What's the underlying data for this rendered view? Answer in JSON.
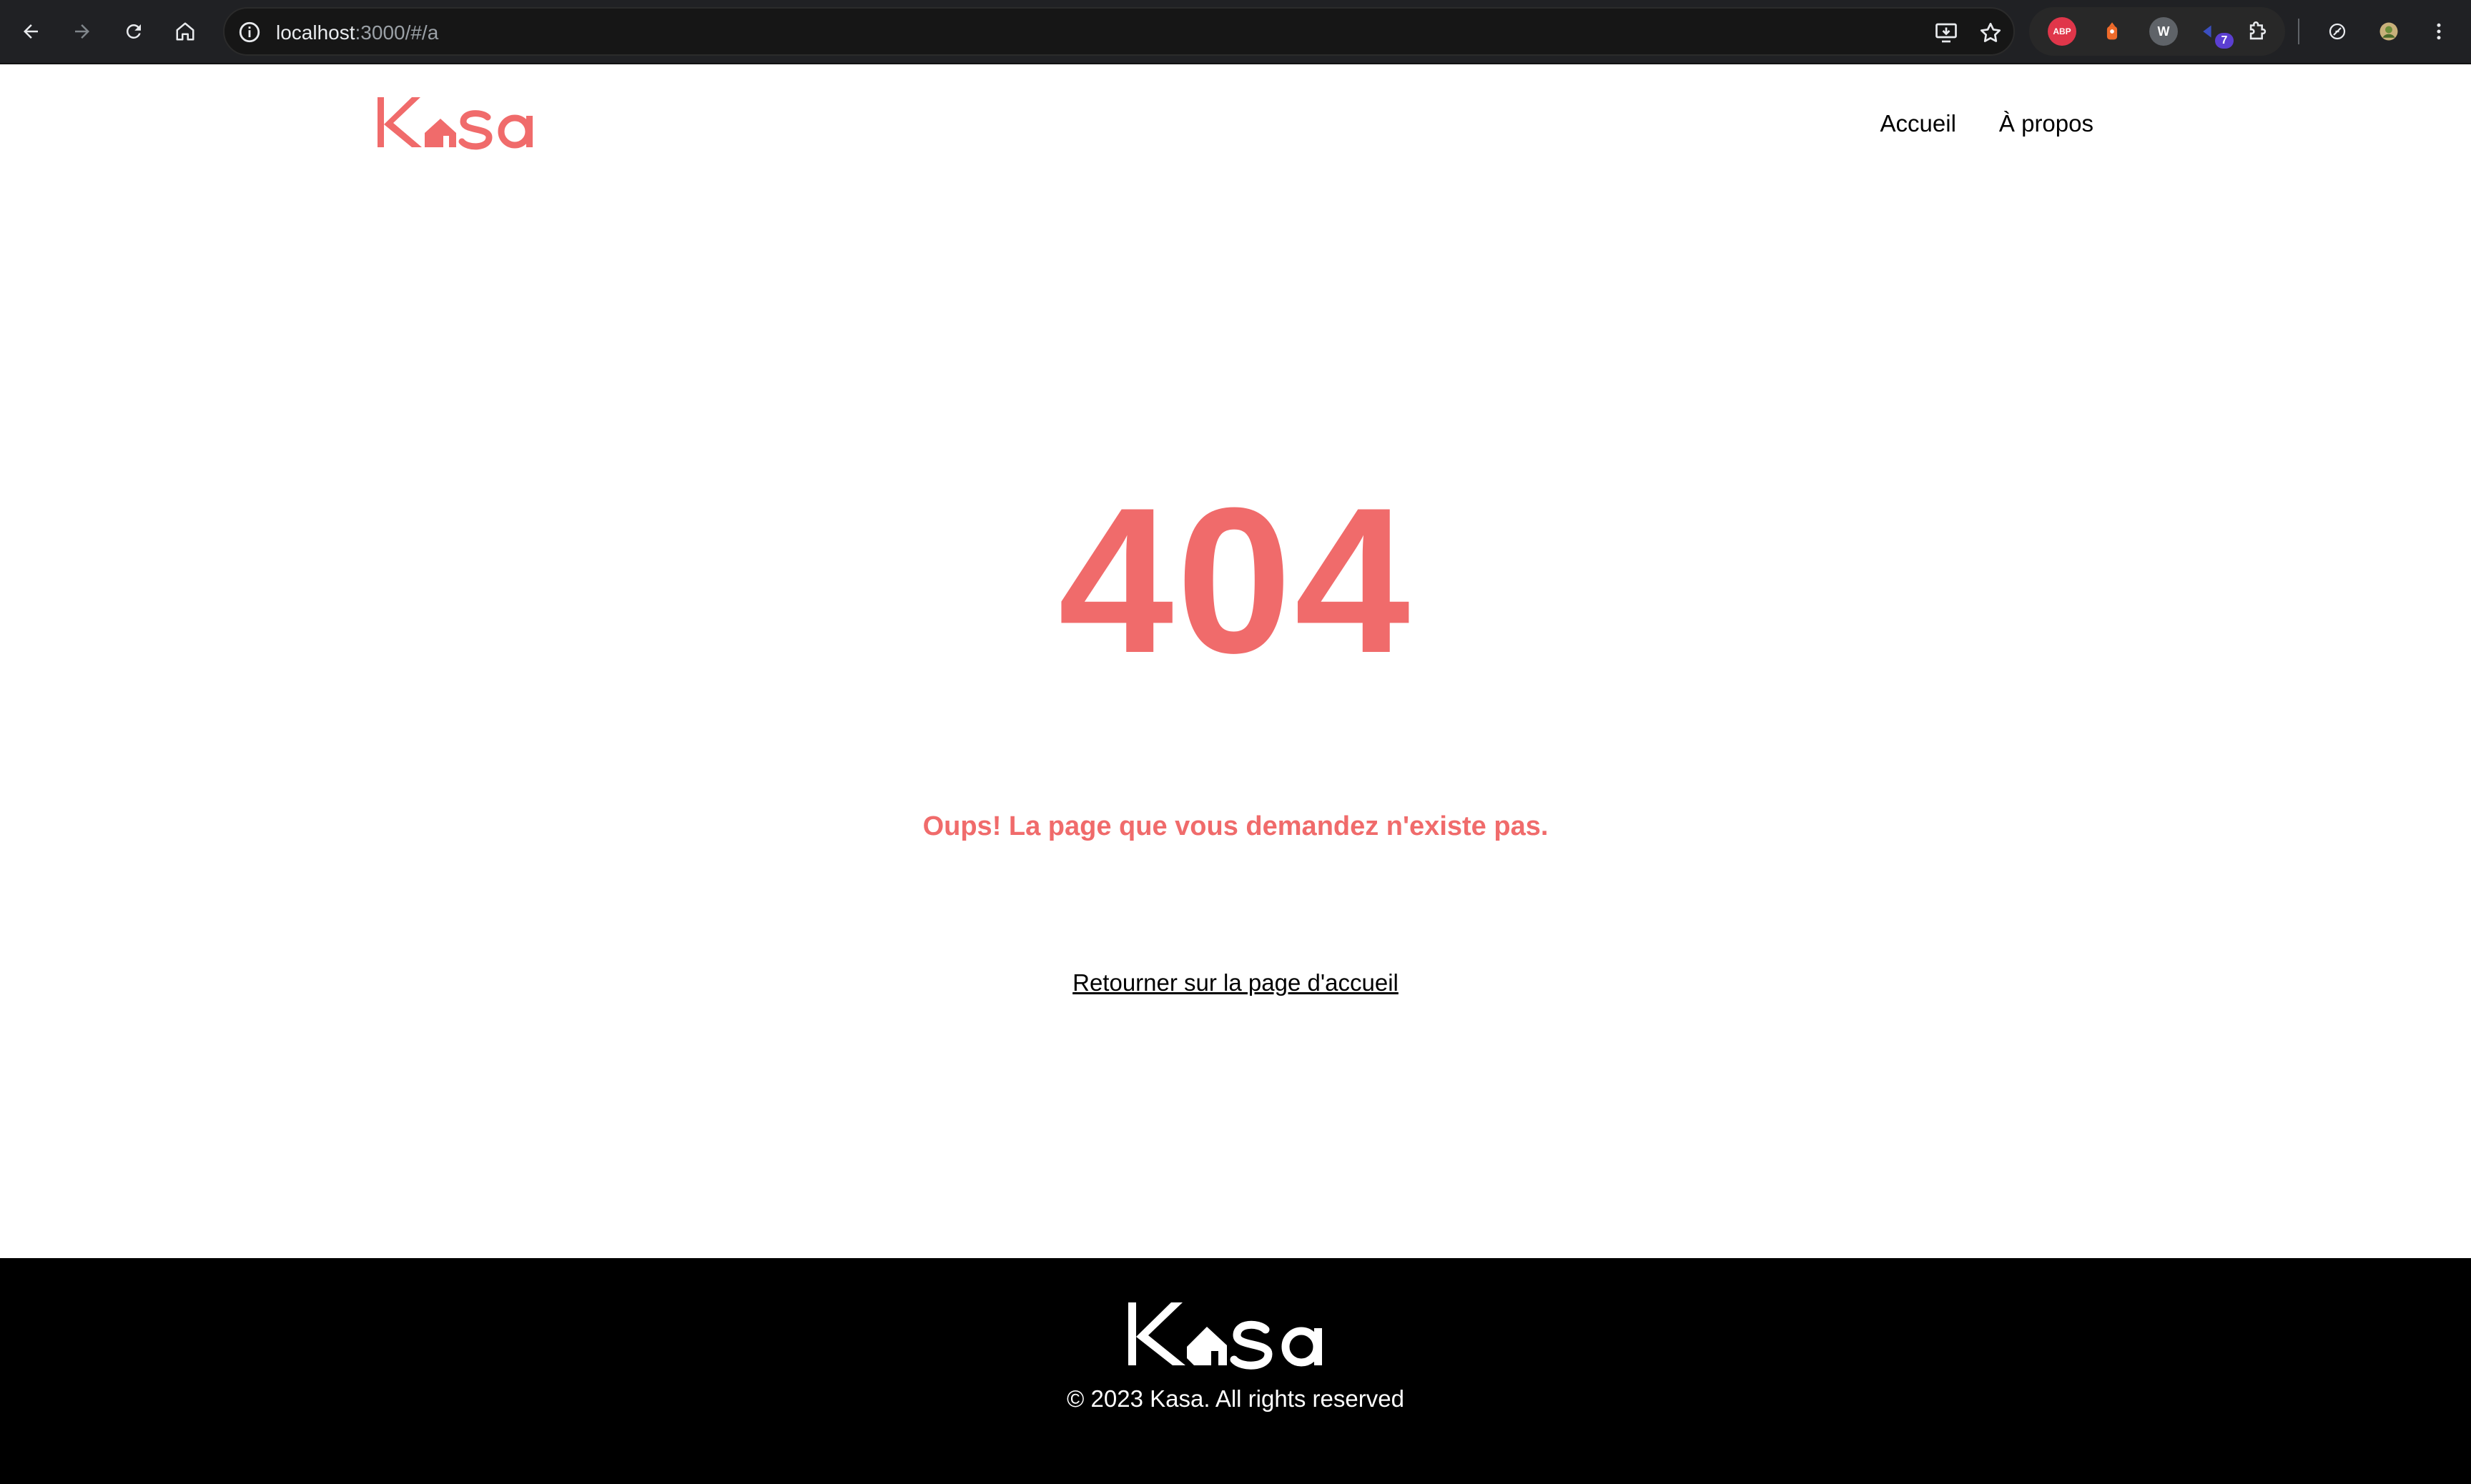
{
  "browser": {
    "url_host": "localhost",
    "url_rest": ":3000/#/a",
    "extensions": [
      {
        "name": "adblock-plus",
        "label": "ABP",
        "color": "#e0364a"
      },
      {
        "name": "fox-extension",
        "label": "",
        "color": "#f06b2a"
      },
      {
        "name": "w-extension",
        "label": "W",
        "color": "#9aa0a6"
      },
      {
        "name": "badge-extension",
        "label": "",
        "color": "#2a3b8f",
        "badge": "7"
      }
    ]
  },
  "header": {
    "logo_text": "Kasa",
    "nav": {
      "home": "Accueil",
      "about": "À propos"
    }
  },
  "main": {
    "code": "404",
    "message": "Oups! La page que vous demandez n'existe pas.",
    "back_link": "Retourner sur la page d'accueil"
  },
  "footer": {
    "logo_text": "Kasa",
    "copyright": "© 2023 Kasa. All rights reserved"
  },
  "colors": {
    "brand": "#f06b6b",
    "chrome_bg": "#202124",
    "footer_bg": "#000000"
  }
}
